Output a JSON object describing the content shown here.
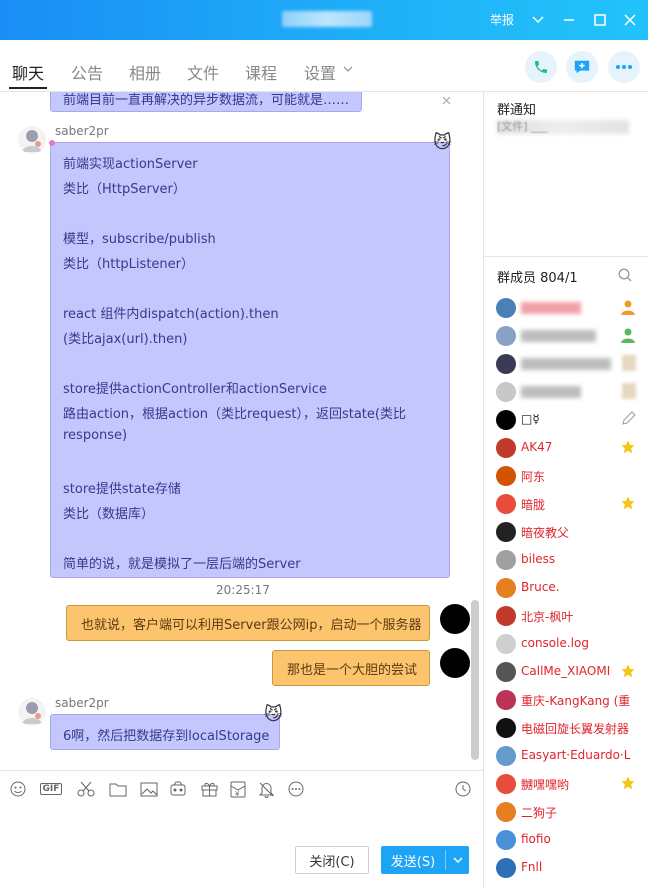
{
  "window": {
    "report_label": "举报",
    "controls": [
      "chevron-down-icon",
      "minimize-icon",
      "maximize-icon",
      "close-icon"
    ]
  },
  "tabs": [
    {
      "label": "聊天",
      "active": true
    },
    {
      "label": "公告",
      "active": false
    },
    {
      "label": "相册",
      "active": false
    },
    {
      "label": "文件",
      "active": false
    },
    {
      "label": "课程",
      "active": false
    },
    {
      "label": "设置",
      "active": false
    }
  ],
  "header_actions": [
    "phone-icon",
    "add-chat-icon",
    "more-icon"
  ],
  "chat": {
    "truncated_top": "前端目前一直再解决的异步数据流，可能就是……",
    "msg1": {
      "nick": "saber2pr",
      "lines": [
        "前端实现actionServer",
        "类比（HttpServer）",
        "",
        "模型，subscribe/publish",
        "类比（httpListener）",
        "",
        "react 组件内dispatch(action).then",
        "(类比ajax(url).then)",
        "",
        "store提供actionController和actionService",
        "路由action，根据action（类比request），返回state(类比",
        "response)",
        "",
        "store提供state存储",
        "类比（数据库）",
        "",
        "简单的说，就是模拟了一层后端的Server"
      ]
    },
    "time": "20:25:17",
    "msg2": "也就说，客户端可以利用Server跟公网ip，启动一个服务器",
    "msg3": "那也是一个大胆的尝试",
    "msg4": {
      "nick": "saber2pr",
      "text": "6啊，然后把数据存到localStorage"
    }
  },
  "toolbar_icons": [
    "emoji-icon",
    "gif-icon",
    "scissors-icon",
    "folder-icon",
    "image-icon",
    "video-icon",
    "gift-icon",
    "red-packet-icon",
    "mute-bell-icon",
    "more-circle-icon",
    "history-clock-icon"
  ],
  "toolbar_gif": "GIF",
  "buttons": {
    "close": "关闭(C)",
    "send": "发送(S)"
  },
  "sidebar": {
    "notice_title": "群通知",
    "notice_text": "[文件] ___",
    "members_title": "群成员 804/1",
    "members": [
      {
        "name": "",
        "blurred": true,
        "badge": "admin-person-orange"
      },
      {
        "name": "",
        "blurred": true,
        "badge": "admin-person-green"
      },
      {
        "name": "",
        "blurred": true,
        "badge": "blurred-badge"
      },
      {
        "name": "",
        "blurred": true,
        "badge": "blurred-badge"
      },
      {
        "name": "□☿",
        "blurred": false,
        "black": true,
        "badge": "edit-pen"
      },
      {
        "name": "AK47",
        "blurred": false,
        "badge": "star"
      },
      {
        "name": "阿东",
        "blurred": false,
        "badge": ""
      },
      {
        "name": "暗胧",
        "blurred": false,
        "badge": "star"
      },
      {
        "name": "暗夜教父",
        "blurred": false,
        "badge": ""
      },
      {
        "name": "biless",
        "blurred": false,
        "badge": ""
      },
      {
        "name": "Bruce.",
        "blurred": false,
        "badge": ""
      },
      {
        "name": "北京-枫叶",
        "blurred": false,
        "badge": ""
      },
      {
        "name": "console.log",
        "blurred": false,
        "badge": ""
      },
      {
        "name": "CallMe_XIAOMI",
        "blurred": false,
        "badge": "star"
      },
      {
        "name": "重庆-KangKang (重",
        "blurred": false,
        "badge": ""
      },
      {
        "name": "电磁回旋长翼发射器",
        "blurred": false,
        "badge": ""
      },
      {
        "name": "Easyart·Eduardo·Leu",
        "blurred": false,
        "badge": ""
      },
      {
        "name": "嬲嘿嘿哟",
        "blurred": false,
        "badge": "star"
      },
      {
        "name": "二狗子",
        "blurred": false,
        "badge": ""
      },
      {
        "name": "fiofio",
        "blurred": false,
        "badge": ""
      },
      {
        "name": "Fnll",
        "blurred": false,
        "badge": ""
      }
    ]
  },
  "colors": {
    "titlebar": "#1a8ef5",
    "bubble_purple": "#c4c7fd",
    "bubble_orange": "#fbc46d",
    "member_name": "#e0242c",
    "send_button": "#1ea4f5"
  }
}
